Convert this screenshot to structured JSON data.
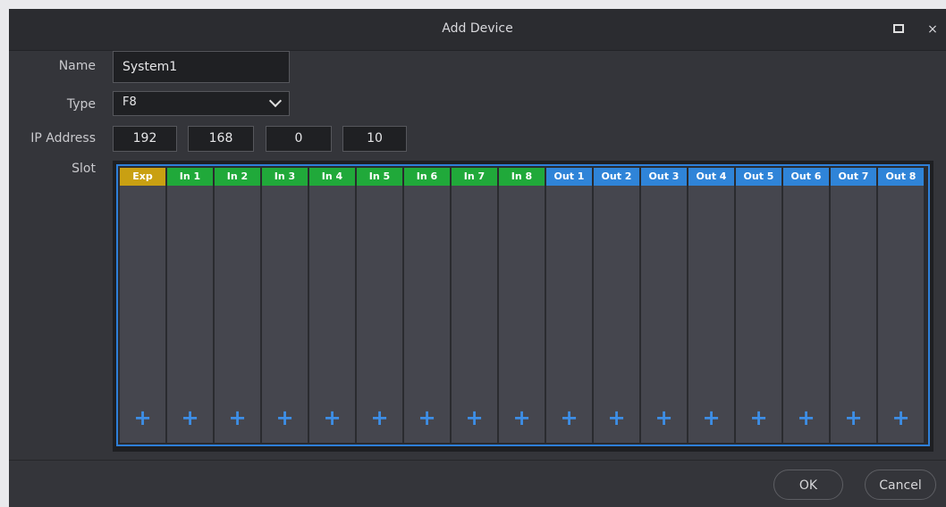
{
  "dialog": {
    "title": "Add Device",
    "maximize_icon": "maximize-icon",
    "close_icon": "close-icon",
    "close_glyph": "×"
  },
  "form": {
    "name_label": "Name",
    "name_value": "System1",
    "type_label": "Type",
    "type_value": "F8",
    "ip_label": "IP Address",
    "ip_octets": [
      "192",
      "168",
      "0",
      "10"
    ],
    "slot_label": "Slot"
  },
  "slots": [
    {
      "label": "Exp",
      "color": "#c9a012"
    },
    {
      "label": "In 1",
      "color": "#20a93a"
    },
    {
      "label": "In 2",
      "color": "#20a93a"
    },
    {
      "label": "In 3",
      "color": "#20a93a"
    },
    {
      "label": "In 4",
      "color": "#20a93a"
    },
    {
      "label": "In 5",
      "color": "#20a93a"
    },
    {
      "label": "In 6",
      "color": "#20a93a"
    },
    {
      "label": "In 7",
      "color": "#20a93a"
    },
    {
      "label": "In 8",
      "color": "#20a93a"
    },
    {
      "label": "Out 1",
      "color": "#2f84d8"
    },
    {
      "label": "Out 2",
      "color": "#2f84d8"
    },
    {
      "label": "Out 3",
      "color": "#2f84d8"
    },
    {
      "label": "Out 4",
      "color": "#2f84d8"
    },
    {
      "label": "Out 5",
      "color": "#2f84d8"
    },
    {
      "label": "Out 6",
      "color": "#2f84d8"
    },
    {
      "label": "Out 7",
      "color": "#2f84d8"
    },
    {
      "label": "Out 8",
      "color": "#2f84d8"
    }
  ],
  "slot_add_icon": "plus-icon",
  "slot_add_glyph": "+",
  "buttons": {
    "ok_label": "OK",
    "cancel_label": "Cancel"
  },
  "colors": {
    "accent": "#2e7fd8",
    "exp": "#c9a012",
    "input": "#20a93a",
    "output": "#2f84d8"
  }
}
